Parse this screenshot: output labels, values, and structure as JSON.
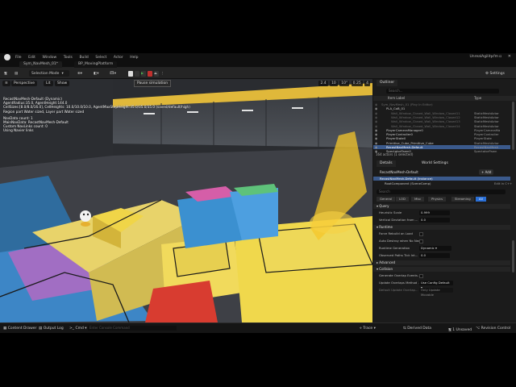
{
  "menu": [
    "File",
    "Edit",
    "Window",
    "Tools",
    "Build",
    "Select",
    "Actor",
    "Help"
  ],
  "tabs": {
    "level": "Sym_NavMesh_01*",
    "blueprint": "BP_MovingPlatform"
  },
  "project_name": "UnrealAgility.fm",
  "toolbar": {
    "selection_mode": "Selection Mode",
    "settings": "Settings"
  },
  "tooltip": "Pause simulation",
  "viewport": {
    "perspective": "Perspective",
    "lit": "Lit",
    "show": "Show",
    "readouts": [
      "2.4",
      "10",
      "10°",
      "0.25",
      "4"
    ],
    "debug_lines": [
      "RecastNavMesh-Default (Dynamic)",
      "AgentRadius:35.0, AgentHeight:144.0",
      "CellSizes:[8.0/8.0/16.0], CellHeights: 10.0/10.0/10.0, AgentMaxStepHeight:35.0/35.0/35.0 (saved/default/high)",
      "Region part Water sized, Layer part Water sized"
    ],
    "debug_lines2": [
      "NavData count: 1",
      "MainNavData: RecastNavMesh-Default",
      "Custom NavLinks count: 0",
      "Using Navier links"
    ]
  },
  "outliner": {
    "title": "Outliner",
    "search_placeholder": "Search...",
    "col_label": "Item Label",
    "col_type": "Type",
    "rows": [
      {
        "name": "Sym_NavMesh_01 (Play In Editor)",
        "type": "",
        "dim": true
      },
      {
        "name": "PLA_CoB_01",
        "type": "",
        "dim": false
      },
      {
        "name": "Wall_Window_Closed_Wall_Window_Closed11",
        "type": "StaticMeshActor",
        "dim": true
      },
      {
        "name": "Wall_Window_Closed_Wall_Window_Closed12",
        "type": "StaticMeshActor",
        "dim": true
      },
      {
        "name": "Wall_Window_Closed_Wall_Window_Closed13",
        "type": "StaticMeshActor",
        "dim": true
      },
      {
        "name": "Wall_Window_Closed_Wall_Window_Closed14",
        "type": "StaticMeshActor",
        "dim": true
      },
      {
        "name": "PlayerCameraManager0",
        "type": "PlayerCameraMa",
        "dim": false
      },
      {
        "name": "PlayerController0",
        "type": "PlayerController",
        "dim": false
      },
      {
        "name": "PlayerState0",
        "type": "PlayerState",
        "dim": false
      },
      {
        "name": "Primitive_Cube_Primitive_Cube",
        "type": "StaticMeshActor",
        "dim": false
      },
      {
        "name": "RecastNavMesh-Default",
        "type": "RecastNavMesh",
        "dim": false,
        "selected": true
      },
      {
        "name": "SpectatorPawn0",
        "type": "SpectatorPawn",
        "dim": false
      }
    ],
    "summary": "164 actors (1 selected)"
  },
  "details": {
    "tab": "Details",
    "tab2": "World Settings",
    "actor": "RecastNavMesh-Default",
    "add": "Add",
    "component_root": "RecastNavMesh-Default (Instance)",
    "component_child": "RootComponent (SceneComp)",
    "edit_link": "Edit in C++",
    "search_placeholder": "Search",
    "filters": [
      "General",
      "LOD",
      "Misc",
      "Physics",
      "Streaming",
      "All"
    ],
    "sections": {
      "query": "Query",
      "runtime": "Runtime",
      "advanced": "Advanced",
      "collision": "Collision"
    },
    "query_props": [
      {
        "label": "Heuristic Scale",
        "value": "0.999"
      },
      {
        "label": "Vertical Deviation from ...",
        "value": "0.0"
      }
    ],
    "runtime_props": [
      {
        "label": "Force Rebuild on Load",
        "value": ""
      },
      {
        "label": "Auto Destroy when No Nav...",
        "value": ""
      },
      {
        "label": "Runtime Generation",
        "value": "Dynamic"
      },
      {
        "label": "Observed Paths Tick Int...",
        "value": "0.0"
      }
    ],
    "collision_props": [
      {
        "label": "Generate Overlap Events ...",
        "value": ""
      },
      {
        "label": "Update Overlaps Method ...",
        "value": "Use Config Default"
      },
      {
        "label": "Default Update Overlap...",
        "value": "Only Update Movable"
      }
    ]
  },
  "status": {
    "content_drawer": "Content Drawer",
    "output_log": "Output Log",
    "cmd": "Cmd",
    "cmd_placeholder": "Enter Console Command",
    "trace": "Trace",
    "derived_data": "Derived Data",
    "unsaved": "1 Unsaved",
    "revision": "Revision Control"
  }
}
